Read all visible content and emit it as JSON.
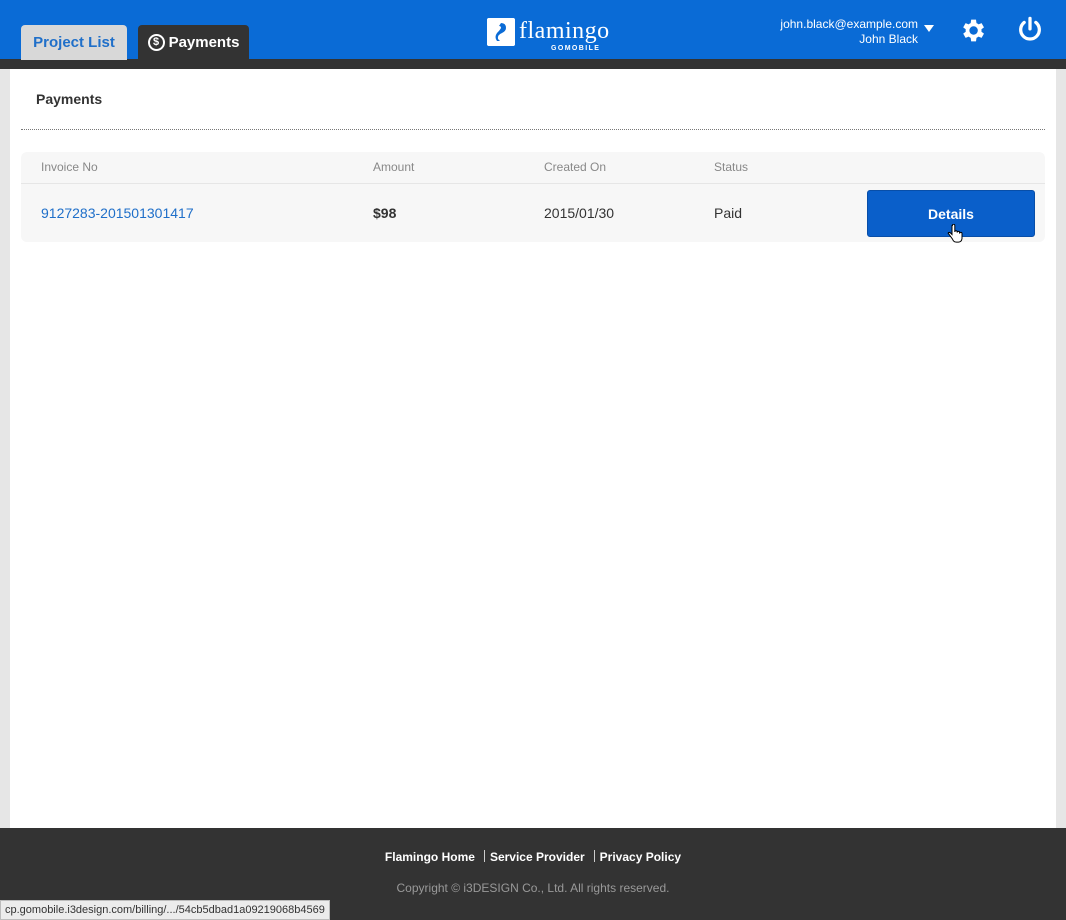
{
  "tabs": [
    {
      "label": "Project List",
      "active": false
    },
    {
      "label": "Payments",
      "active": true,
      "icon": "dollar-coin-icon"
    }
  ],
  "logo": {
    "name": "flamingo",
    "sub": "GOMOBILE"
  },
  "user": {
    "email": "john.black@example.com",
    "name": "John Black"
  },
  "page": {
    "title": "Payments"
  },
  "table": {
    "headers": [
      "Invoice No",
      "Amount",
      "Created On",
      "Status"
    ],
    "rows": [
      {
        "invoice": "9127283-201501301417",
        "amount": "$98",
        "created_on": "2015/01/30",
        "status": "Paid",
        "action": "Details"
      }
    ]
  },
  "footer": {
    "links": [
      "Flamingo Home",
      "Service Provider",
      "Privacy Policy"
    ],
    "copyright": "Copyright © i3DESIGN Co., Ltd. All rights reserved."
  },
  "statusbar": {
    "url": "cp.gomobile.i3design.com/billing/.../54cb5dbad1a09219068b4569"
  },
  "colors": {
    "header": "#0a6bd6",
    "accent": "#1f6fc9",
    "button": "#0a5fca",
    "footer": "#333333"
  }
}
